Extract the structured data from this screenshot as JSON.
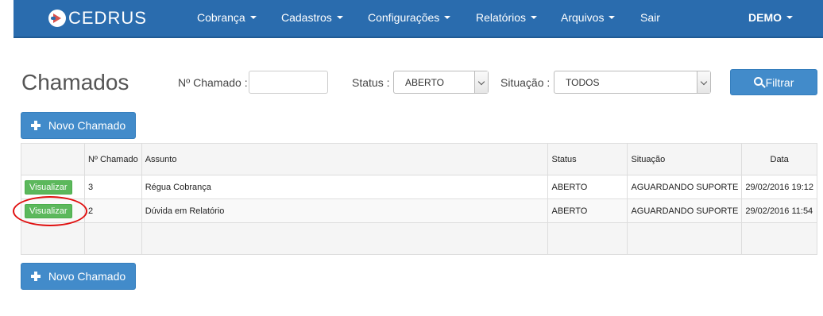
{
  "navbar": {
    "brand": "CEDRUS",
    "menu": [
      {
        "label": "Cobrança",
        "has_caret": true
      },
      {
        "label": "Cadastros",
        "has_caret": true
      },
      {
        "label": "Configurações",
        "has_caret": true
      },
      {
        "label": "Relatórios",
        "has_caret": true
      },
      {
        "label": "Arquivos",
        "has_caret": true
      },
      {
        "label": "Sair",
        "has_caret": false
      }
    ],
    "user": "DEMO"
  },
  "page": {
    "title": "Chamados"
  },
  "filters": {
    "numero_label": "Nº Chamado :",
    "numero_value": "",
    "status_label": "Status :",
    "status_value": "ABERTO",
    "situacao_label": "Situação :",
    "situacao_value": "TODOS",
    "filter_button": "Filtrar"
  },
  "actions": {
    "new_ticket_top": "Novo Chamado",
    "new_ticket_bottom": "Novo Chamado"
  },
  "table": {
    "headers": [
      "",
      "Nº Chamado",
      "Assunto",
      "Status",
      "Situação",
      "Data"
    ],
    "rows": [
      {
        "action": "Visualizar",
        "numero": "3",
        "assunto": "Régua Cobrança",
        "status": "ABERTO",
        "situacao": "AGUARDANDO SUPORTE",
        "data": "29/02/2016 19:12"
      },
      {
        "action": "Visualizar",
        "numero": "2",
        "assunto": "Dúvida em Relatório",
        "status": "ABERTO",
        "situacao": "AGUARDANDO SUPORTE",
        "data": "29/02/2016 11:54"
      }
    ]
  },
  "colors": {
    "navbar": "#2a6cae",
    "primary": "#428bca",
    "success": "#5cb85c",
    "annotation": "#e01010"
  }
}
